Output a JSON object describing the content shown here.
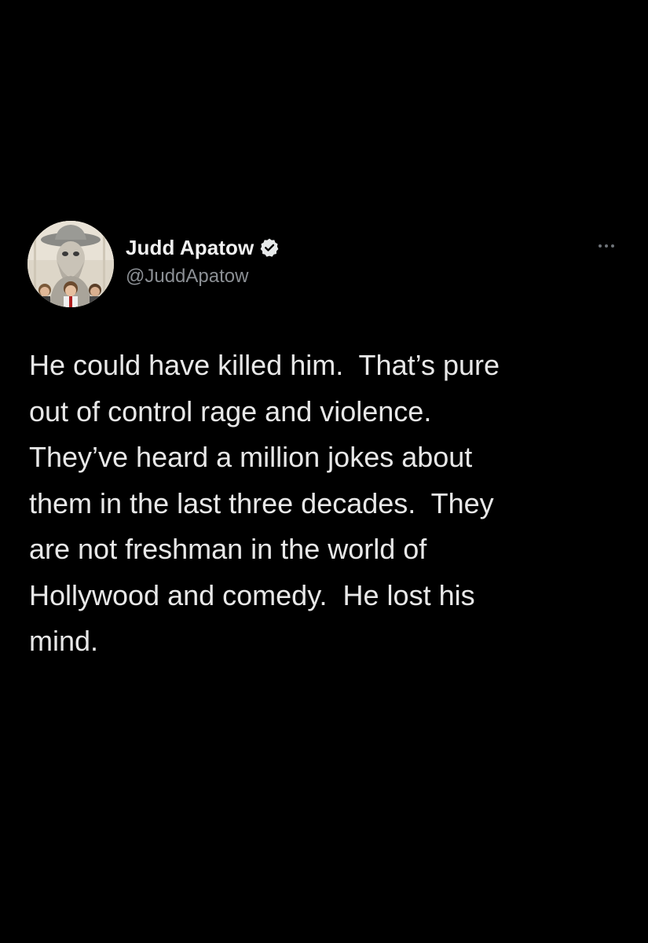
{
  "author": {
    "display_name": "Judd Apatow",
    "handle": "@JuddApatow",
    "verified": true,
    "avatar_icon": "profile-avatar"
  },
  "actions": {
    "more_icon": "more-horizontal-icon"
  },
  "tweet": {
    "lines": [
      "He could have killed him.  That’s pure",
      "out of control rage and violence.",
      "They’ve heard a million jokes about",
      "them in the last three decades.  They",
      "are not freshman in the world of",
      "Hollywood and comedy.  He lost his",
      "mind."
    ]
  },
  "colors": {
    "background": "#000000",
    "text": "#e8e8e8",
    "secondary_text": "#8b8f94",
    "verified_badge": "#e7e9ea"
  }
}
